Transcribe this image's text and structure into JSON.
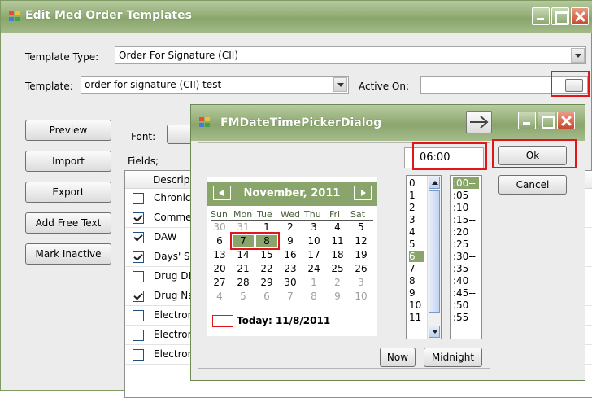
{
  "window": {
    "title": "Edit Med Order Templates"
  },
  "form": {
    "template_type_label": "Template Type:",
    "template_type_value": "Order For Signature (CII)",
    "template_label": "Template:",
    "template_value": "order for signature (CII) test",
    "active_on_label": "Active On:",
    "font_label": "Font:",
    "fields_label": "Fields;"
  },
  "buttons": {
    "preview": "Preview",
    "import": "Import",
    "export": "Export",
    "add_free_text": "Add Free Text",
    "mark_inactive": "Mark Inactive"
  },
  "fields": {
    "column_header": "Descrip",
    "rows": [
      {
        "label": "Chronic",
        "checked": false
      },
      {
        "label": "Commer",
        "checked": true
      },
      {
        "label": "DAW",
        "checked": true
      },
      {
        "label": "Days' Si",
        "checked": true
      },
      {
        "label": "Drug DE",
        "checked": false
      },
      {
        "label": "Drug Na",
        "checked": true
      },
      {
        "label": "Electron",
        "checked": false
      },
      {
        "label": "Electron",
        "checked": false
      },
      {
        "label": "Electronic Transmission Failure",
        "checked": false
      }
    ]
  },
  "dialog": {
    "title": "FMDateTimePickerDialog",
    "time_value": "06:00",
    "ok_label": "Ok",
    "cancel_label": "Cancel",
    "now_label": "Now",
    "midnight_label": "Midnight",
    "calendar": {
      "month_title": "November, 2011",
      "weekdays": [
        "Sun",
        "Mon",
        "Tue",
        "Wed",
        "Thu",
        "Fri",
        "Sat"
      ],
      "weeks": [
        [
          "30",
          "31",
          "1",
          "2",
          "3",
          "4",
          "5"
        ],
        [
          "6",
          "7",
          "8",
          "9",
          "10",
          "11",
          "12"
        ],
        [
          "13",
          "14",
          "15",
          "16",
          "17",
          "18",
          "19"
        ],
        [
          "20",
          "21",
          "22",
          "23",
          "24",
          "25",
          "26"
        ],
        [
          "27",
          "28",
          "29",
          "30",
          "1",
          "2",
          "3"
        ],
        [
          "4",
          "5",
          "6",
          "7",
          "8",
          "9",
          "10"
        ]
      ],
      "today_label": "Today: 11/8/2011"
    },
    "hours": [
      "0",
      "1",
      "2",
      "3",
      "4",
      "5",
      "6",
      "7",
      "8",
      "9",
      "10",
      "11"
    ],
    "selected_hour": "6",
    "minutes": [
      ":00--",
      ":05",
      ":10",
      ":15--",
      ":20",
      ":25",
      ":30--",
      ":35",
      ":40",
      ":45--",
      ":50",
      ":55"
    ],
    "selected_minute": ":00--"
  }
}
